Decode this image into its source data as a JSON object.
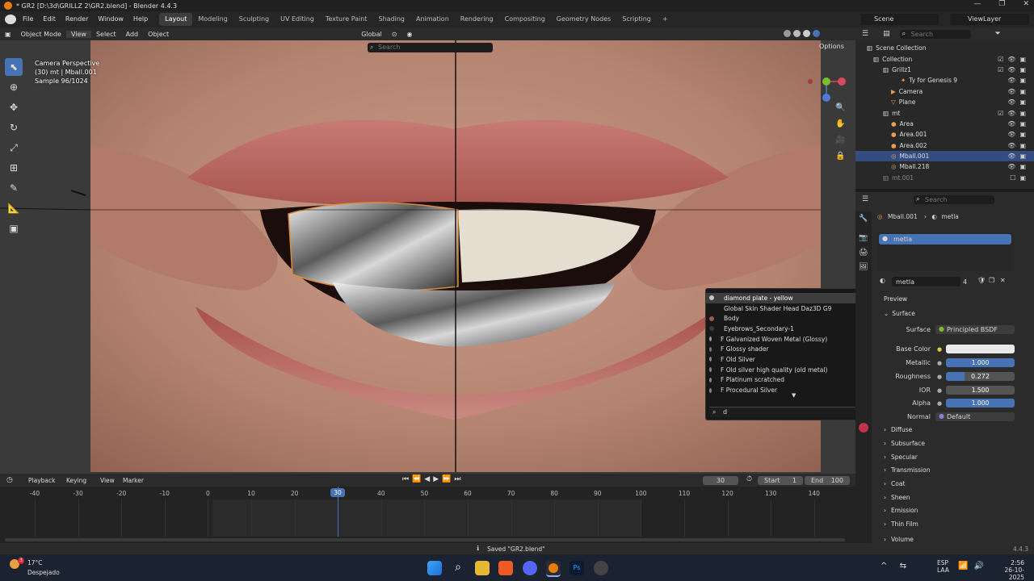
{
  "window": {
    "title": "* GR2 [D:\\3d\\GRILLZ 2\\GR2.blend] - Blender 4.4.3",
    "controls": [
      "—",
      "❐",
      "✕"
    ]
  },
  "menu": [
    "File",
    "Edit",
    "Render",
    "Window",
    "Help"
  ],
  "workspaces": [
    "Layout",
    "Modeling",
    "Sculpting",
    "UV Editing",
    "Texture Paint",
    "Shading",
    "Animation",
    "Rendering",
    "Compositing",
    "Geometry Nodes",
    "Scripting"
  ],
  "workspace_add": "+",
  "scene": {
    "label": "Scene",
    "view_layer": "ViewLayer"
  },
  "viewport_header": {
    "mode": "Object Mode",
    "items": [
      "View",
      "Select",
      "Add",
      "Object"
    ],
    "transform": "Global",
    "search_placeholder": "Search",
    "options": "Options"
  },
  "overlay_info": {
    "line1": "Camera Perspective",
    "line2": "(30) mt | Mball.001",
    "line3": "Sample 96/1024"
  },
  "material_dropdown": {
    "items": [
      {
        "name": "diamond plate - yellow",
        "color": "#c7c7c7"
      },
      {
        "name": "Global Skin Shader Head Daz3D G9",
        "color": ""
      },
      {
        "name": "Body",
        "color": "#9b5a52"
      },
      {
        "name": "Eyebrows_Secondary-1",
        "color": "#3a3a3a"
      },
      {
        "name": "F Galvanized Woven Metal (Glossy)",
        "color": "#9a9a9a"
      },
      {
        "name": "F Glossy shader",
        "color": "#777"
      },
      {
        "name": "F Old Silver",
        "color": "#888"
      },
      {
        "name": "F Old silver high quality (old metal)",
        "color": "#888"
      },
      {
        "name": "F Platinum scratched",
        "color": "#888"
      },
      {
        "name": "F Procedural Silver",
        "color": "#888"
      }
    ],
    "more_arrow": "▼",
    "search_value": "d"
  },
  "outliner": {
    "search_placeholder": "Search",
    "rows": [
      {
        "name": "Scene Collection",
        "indent": 0
      },
      {
        "name": "Collection",
        "indent": 1
      },
      {
        "name": "Grillz1",
        "indent": 2
      },
      {
        "name": "Ty for Genesis 9",
        "indent": 3
      },
      {
        "name": "Camera",
        "indent": 2
      },
      {
        "name": "Plane",
        "indent": 2
      },
      {
        "name": "mt",
        "indent": 1
      },
      {
        "name": "Area",
        "indent": 2
      },
      {
        "name": "Area.001",
        "indent": 2
      },
      {
        "name": "Area.002",
        "indent": 2
      },
      {
        "name": "Mball.001",
        "indent": 2
      },
      {
        "name": "Mball.218",
        "indent": 2
      },
      {
        "name": "mt.001",
        "indent": 1
      }
    ]
  },
  "properties": {
    "search_placeholder": "Search",
    "breadcrumb_object": "Mball.001",
    "breadcrumb_material": "metla",
    "slot": "metla",
    "material_name": "metla",
    "user_count": "4",
    "preview_label": "Preview",
    "surface_panel": "Surface",
    "fields": [
      {
        "label": "Surface",
        "value": "Principled BSDF"
      },
      {
        "label": "Base Color",
        "value": ""
      },
      {
        "label": "Metallic",
        "value": "1.000"
      },
      {
        "label": "Roughness",
        "value": "0.272"
      },
      {
        "label": "IOR",
        "value": "1.500"
      },
      {
        "label": "Alpha",
        "value": "1.000"
      },
      {
        "label": "Normal",
        "value": "Default"
      }
    ],
    "subpanels": [
      "Diffuse",
      "Subsurface",
      "Specular",
      "Transmission",
      "Coat",
      "Sheen",
      "Emission",
      "Thin Film",
      "Volume"
    ]
  },
  "timeline": {
    "menu": [
      "Playback",
      "Keying",
      "View",
      "Marker"
    ],
    "current_frame": "30",
    "start_label": "Start",
    "start": "1",
    "end_label": "End",
    "end": "100",
    "ticks": [
      "-40",
      "-30",
      "-20",
      "-10",
      "0",
      "10",
      "20",
      "30",
      "40",
      "50",
      "60",
      "70",
      "80",
      "90",
      "100",
      "110",
      "120",
      "130",
      "140"
    ],
    "playhead": "30"
  },
  "status": {
    "message": "Saved \"GR2.blend\"",
    "version": "4.4.3"
  },
  "taskbar": {
    "weather_temp": "17°C",
    "weather_desc": "Despejado",
    "lang": "ESP",
    "lang2": "LAA",
    "time": "2:56",
    "date": "26-10-2025",
    "notif_badge": "3"
  }
}
